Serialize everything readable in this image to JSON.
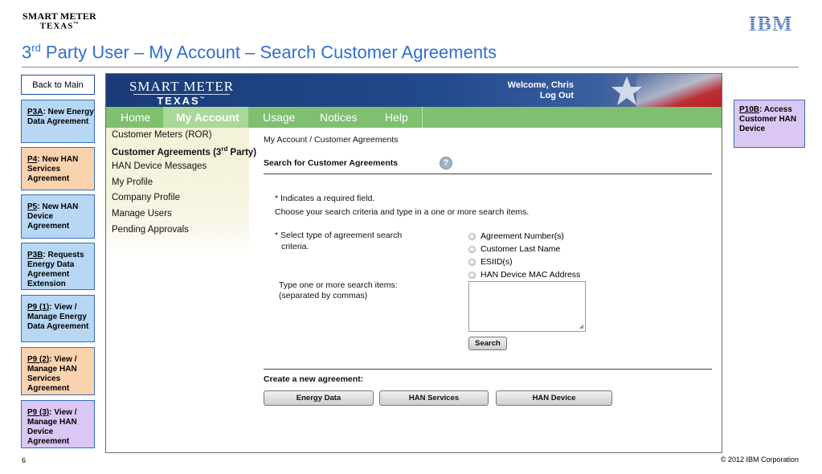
{
  "slide": {
    "logo_line1": "SMART METER",
    "logo_line2": "TEXAS",
    "logo_tm": "™",
    "ibm_logo": "IBM",
    "title_prefix": "3",
    "title_sup": "rd",
    "title_rest": " Party User – My Account – Search Customer Agreements",
    "page_number": "6",
    "copyright": "© 2012 IBM Corporation"
  },
  "left_nav": {
    "back": "Back to Main",
    "boxes": [
      {
        "code": "P3A",
        "text": ": New Energy Data Agreement"
      },
      {
        "code": "P4",
        "text": ": New HAN Services Agreement"
      },
      {
        "code": "P5",
        "text": ": New HAN Device Agreement"
      },
      {
        "code": "P3B",
        "text": ": Requests Energy Data Agreement Extension"
      },
      {
        "code": "P9 (1)",
        "text": ": View / Manage Energy Data Agreement"
      },
      {
        "code": "P9 (2)",
        "text": ": View / Manage HAN Services Agreement"
      },
      {
        "code": "P9 (3)",
        "text": ": View / Manage HAN Device Agreement"
      }
    ]
  },
  "right_box": {
    "code": "P10B",
    "text": ": Access Customer HAN Device"
  },
  "app": {
    "logo_line1": "SMART METER",
    "logo_line2": "TEXAS",
    "logo_tm": "™",
    "welcome": "Welcome, Chris",
    "logout": "Log Out",
    "menu": [
      "Home",
      "My Account",
      "Usage",
      "Notices",
      "Help"
    ],
    "side_menu": [
      "Customer Meters (ROR)",
      "Customer Agreements (3",
      "HAN Device Messages",
      "My Profile",
      "Company Profile",
      "Manage Users",
      "Pending Approvals"
    ],
    "side_menu_sup": "rd",
    "side_menu_suffix": " Party)",
    "breadcrumb": "My Account / Customer Agreements",
    "search_heading": "Search for Customer Agreements",
    "help_icon": "?",
    "required_note": "* Indicates a required field.",
    "instruction": "Choose your search criteria and type in a one or more search items.",
    "criteria_line1": "*  Select type of agreement search",
    "criteria_line2": "criteria.",
    "radio_options": [
      "Agreement Number(s)",
      "Customer Last Name",
      "ESIID(s)",
      "HAN Device MAC Address"
    ],
    "items_line1": "Type one or more search items:",
    "items_line2": "(separated by commas)",
    "search_button": "Search",
    "create_heading": "Create a new agreement:",
    "create_buttons": [
      "Energy Data",
      "HAN Services",
      "HAN Device"
    ]
  }
}
